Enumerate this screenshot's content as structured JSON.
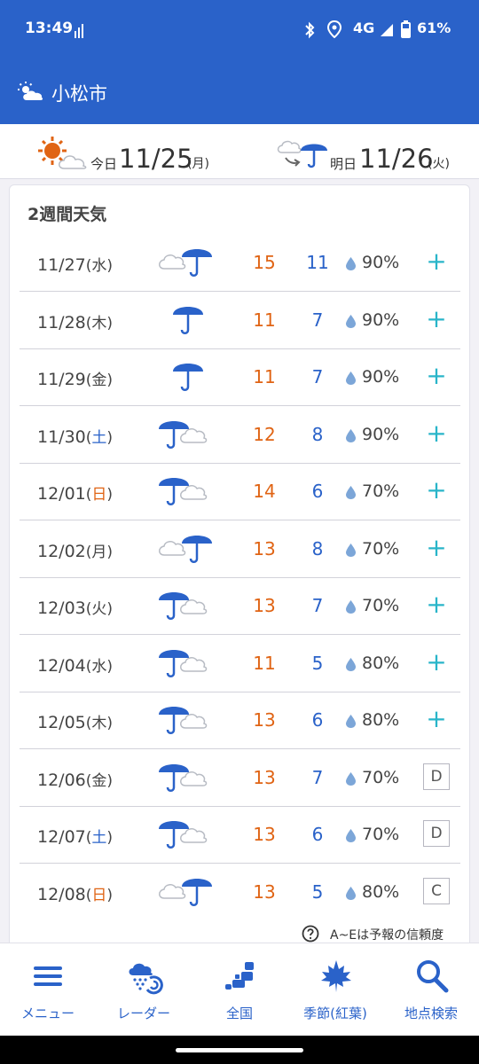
{
  "status": {
    "time": "13:49",
    "network": "4G",
    "battery": "61%"
  },
  "app": {
    "title": "小松市"
  },
  "today": {
    "label": "今日",
    "date": "11/25",
    "dow": "(月)",
    "icon": "sun-cloud-icon"
  },
  "tomorrow": {
    "label": "明日",
    "date": "11/26",
    "dow": "(火)",
    "icon": "cloud-to-rain-icon"
  },
  "forecast": {
    "title": "2週間天気",
    "rows": [
      {
        "date": "11/27",
        "wkday": "(水)",
        "wk_type": "weekday",
        "icon": "cloud-then-rain",
        "high": "15",
        "low": "11",
        "pct": "90%",
        "reliability": "+"
      },
      {
        "date": "11/28",
        "wkday": "(木)",
        "wk_type": "weekday",
        "icon": "rain",
        "high": "11",
        "low": "7",
        "pct": "90%",
        "reliability": "+"
      },
      {
        "date": "11/29",
        "wkday": "(金)",
        "wk_type": "weekday",
        "icon": "rain",
        "high": "11",
        "low": "7",
        "pct": "90%",
        "reliability": "+"
      },
      {
        "date": "11/30",
        "wkday": "(土)",
        "wk_type": "sat",
        "icon": "rain-then-cloud",
        "high": "12",
        "low": "8",
        "pct": "90%",
        "reliability": "+"
      },
      {
        "date": "12/01",
        "wkday": "(日)",
        "wk_type": "sun",
        "icon": "rain-then-cloud",
        "high": "14",
        "low": "6",
        "pct": "70%",
        "reliability": "+"
      },
      {
        "date": "12/02",
        "wkday": "(月)",
        "wk_type": "weekday",
        "icon": "cloud-then-rain",
        "high": "13",
        "low": "8",
        "pct": "70%",
        "reliability": "+"
      },
      {
        "date": "12/03",
        "wkday": "(火)",
        "wk_type": "weekday",
        "icon": "rain-then-cloud",
        "high": "13",
        "low": "7",
        "pct": "70%",
        "reliability": "+"
      },
      {
        "date": "12/04",
        "wkday": "(水)",
        "wk_type": "weekday",
        "icon": "rain-then-cloud",
        "high": "11",
        "low": "5",
        "pct": "80%",
        "reliability": "+"
      },
      {
        "date": "12/05",
        "wkday": "(木)",
        "wk_type": "weekday",
        "icon": "rain-then-cloud",
        "high": "13",
        "low": "6",
        "pct": "80%",
        "reliability": "+"
      },
      {
        "date": "12/06",
        "wkday": "(金)",
        "wk_type": "weekday",
        "icon": "rain-then-cloud",
        "high": "13",
        "low": "7",
        "pct": "70%",
        "reliability": "D"
      },
      {
        "date": "12/07",
        "wkday": "(土)",
        "wk_type": "sat",
        "icon": "rain-then-cloud",
        "high": "13",
        "low": "6",
        "pct": "70%",
        "reliability": "D"
      },
      {
        "date": "12/08",
        "wkday": "(日)",
        "wk_type": "sun",
        "icon": "cloud-then-rain",
        "high": "13",
        "low": "5",
        "pct": "80%",
        "reliability": "C"
      }
    ]
  },
  "note": "A~Eは予報の信頼度",
  "nav": [
    {
      "label": "メニュー",
      "icon": "menu-icon"
    },
    {
      "label": "レーダー",
      "icon": "radar-icon"
    },
    {
      "label": "全国",
      "icon": "nationwide-icon"
    },
    {
      "label": "季節(紅葉)",
      "icon": "maple-leaf-icon"
    },
    {
      "label": "地点検索",
      "icon": "search-icon"
    }
  ],
  "colors": {
    "primary": "#2a62c9",
    "high": "#e06414",
    "plus": "#29b5c9"
  }
}
